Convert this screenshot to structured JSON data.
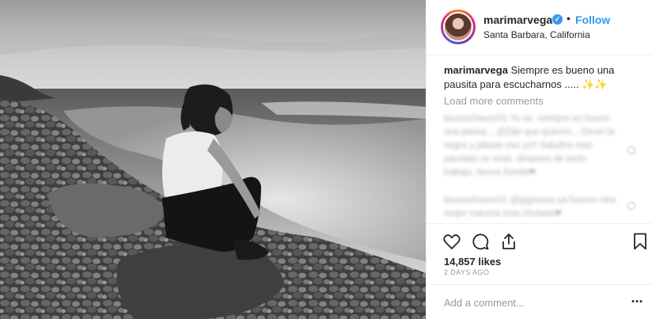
{
  "post": {
    "username": "marimarvega",
    "location": "Santa Barbara, California",
    "follow_label": "Follow",
    "separator": "•",
    "verified_icon": "✓",
    "caption_text": " Siempre es bueno una pausita para escucharnos ..... ✨✨",
    "load_more_label": "Load more comments",
    "blurred_comments": [
      "lauraschavez01 Yo se, siempre es bueno una pausa... @Dije que quieres... Dicen la negra y jalaste eso yo!! Saludos mas pausitas se esas, despues de tanto trabajo, besos bonita❤",
      "lauraschavez01 @gigisoiza ya fueeee otra mejor manera esta chulada❤"
    ],
    "likes_text": "14,857 likes",
    "time_text": "2 DAYS AGO",
    "comment_placeholder": "Add a comment...",
    "more_label": "..."
  },
  "icons": {
    "like": "heart-outline-icon",
    "comment": "speech-bubble-icon",
    "share": "share-upload-icon",
    "save": "bookmark-icon",
    "more": "more-options-icon"
  },
  "colors": {
    "link_blue": "#3897f0",
    "muted_gray": "#999999",
    "border": "#efefef",
    "text": "#262626"
  }
}
